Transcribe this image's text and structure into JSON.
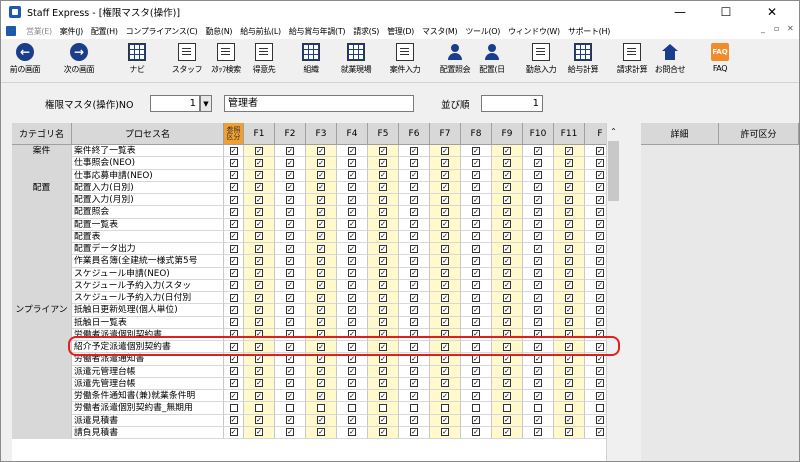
{
  "window": {
    "title": "Staff Express - [権限マスタ(操作)]",
    "controls": [
      "—",
      "☐",
      "✕"
    ]
  },
  "menu": {
    "items": [
      {
        "label": "営業(E)",
        "disabled": true
      },
      {
        "label": "案件(J)",
        "disabled": false
      },
      {
        "label": "配置(H)",
        "disabled": false
      },
      {
        "label": "コンプライアンス(C)",
        "disabled": false
      },
      {
        "label": "勤怠(N)",
        "disabled": false
      },
      {
        "label": "給与前払(L)",
        "disabled": false
      },
      {
        "label": "給与賞与年調(T)",
        "disabled": false
      },
      {
        "label": "請求(S)",
        "disabled": false
      },
      {
        "label": "管理(D)",
        "disabled": false
      },
      {
        "label": "マスタ(M)",
        "disabled": false
      },
      {
        "label": "ツール(O)",
        "disabled": false
      },
      {
        "label": "ウィンドウ(W)",
        "disabled": false
      },
      {
        "label": "サポート(H)",
        "disabled": false
      }
    ],
    "mdi_controls": [
      "_",
      "▫",
      "✕"
    ]
  },
  "toolbar": {
    "buttons": [
      {
        "label": "前の画面",
        "icon": "arrow-left-icon"
      },
      {
        "label": "次の画面",
        "icon": "arrow-right-icon"
      },
      {
        "label": "ナビ",
        "icon": "navi-grid-icon"
      },
      {
        "label": "スタッフ",
        "icon": "staff-doc-icon"
      },
      {
        "label": "ｽﾀｯﾌ検索",
        "icon": "staff-search-icon"
      },
      {
        "label": "得意先",
        "icon": "client-doc-icon"
      },
      {
        "label": "組織",
        "icon": "organization-icon"
      },
      {
        "label": "就業現場",
        "icon": "workplace-icon"
      },
      {
        "label": "案件入力",
        "icon": "job-entry-icon"
      },
      {
        "label": "配置照会",
        "icon": "placement-inquiry-icon"
      },
      {
        "label": "配置(日",
        "icon": "placement-daily-icon"
      },
      {
        "label": "勤怠入力",
        "icon": "attendance-entry-icon"
      },
      {
        "label": "給与計算",
        "icon": "payroll-icon"
      },
      {
        "label": "請求計算",
        "icon": "billing-icon"
      },
      {
        "label": "お問合せ",
        "icon": "contact-icon"
      },
      {
        "label": "FAQ",
        "icon": "faq-icon"
      }
    ]
  },
  "filter": {
    "master_label": "権限マスタ(操作)NO",
    "master_no": "1",
    "master_name": "管理者",
    "order_label": "並び順",
    "order_value": "1"
  },
  "grid": {
    "headers": {
      "category": "カテゴリ名",
      "process": "プロセス名",
      "auth": [
        "参照",
        "区分"
      ],
      "functions": [
        "F1",
        "F2",
        "F3",
        "F4",
        "F5",
        "F6",
        "F7",
        "F8",
        "F9",
        "F10",
        "F11",
        "F"
      ]
    },
    "rows": [
      {
        "category": "案件",
        "process": "案件終了一覧表",
        "checked": true
      },
      {
        "category": "",
        "process": "仕事照会(NEO)",
        "checked": true
      },
      {
        "category": "",
        "process": "仕事応募申請(NEO)",
        "checked": true
      },
      {
        "category": "配置",
        "process": "配置入力(日別)",
        "checked": true
      },
      {
        "category": "",
        "process": "配置入力(月別)",
        "checked": true
      },
      {
        "category": "",
        "process": "配置照会",
        "checked": true
      },
      {
        "category": "",
        "process": "配置一覧表",
        "checked": true
      },
      {
        "category": "",
        "process": "配置表",
        "checked": true
      },
      {
        "category": "",
        "process": "配置データ出力",
        "checked": true
      },
      {
        "category": "",
        "process": "作業員名簿(全建統一様式第5号",
        "checked": true
      },
      {
        "category": "",
        "process": "スケジュール申請(NEO)",
        "checked": true
      },
      {
        "category": "",
        "process": "スケジュール予約入力(スタッ",
        "checked": true
      },
      {
        "category": "",
        "process": "スケジュール予約入力(日付別",
        "checked": true
      },
      {
        "category": "ンプライアン",
        "process": "抵触日更新処理(個人単位)",
        "checked": true
      },
      {
        "category": "",
        "process": "抵触日一覧表",
        "checked": true
      },
      {
        "category": "",
        "process": "労働者派遣個別契約書",
        "checked": true
      },
      {
        "category": "",
        "process": "紹介予定派遣個別契約書",
        "checked": true
      },
      {
        "category": "",
        "process": "労働者派遣通知書",
        "checked": true
      },
      {
        "category": "",
        "process": "派遣元管理台帳",
        "checked": true
      },
      {
        "category": "",
        "process": "派遣先管理台帳",
        "checked": true
      },
      {
        "category": "",
        "process": "労働条件通知書(兼)就業条件明",
        "checked": true
      },
      {
        "category": "",
        "process": "労働者派遣個別契約書_無期用",
        "checked": false
      },
      {
        "category": "",
        "process": "派遣見積書",
        "checked": true
      },
      {
        "category": "",
        "process": "請負見積書",
        "checked": true
      }
    ]
  },
  "right_panel": {
    "headers": [
      "詳細",
      "許可区分"
    ]
  },
  "colors": {
    "auth_header": "#f0a030",
    "yellow_col": "#fff9cc",
    "highlight": "#e02020"
  }
}
